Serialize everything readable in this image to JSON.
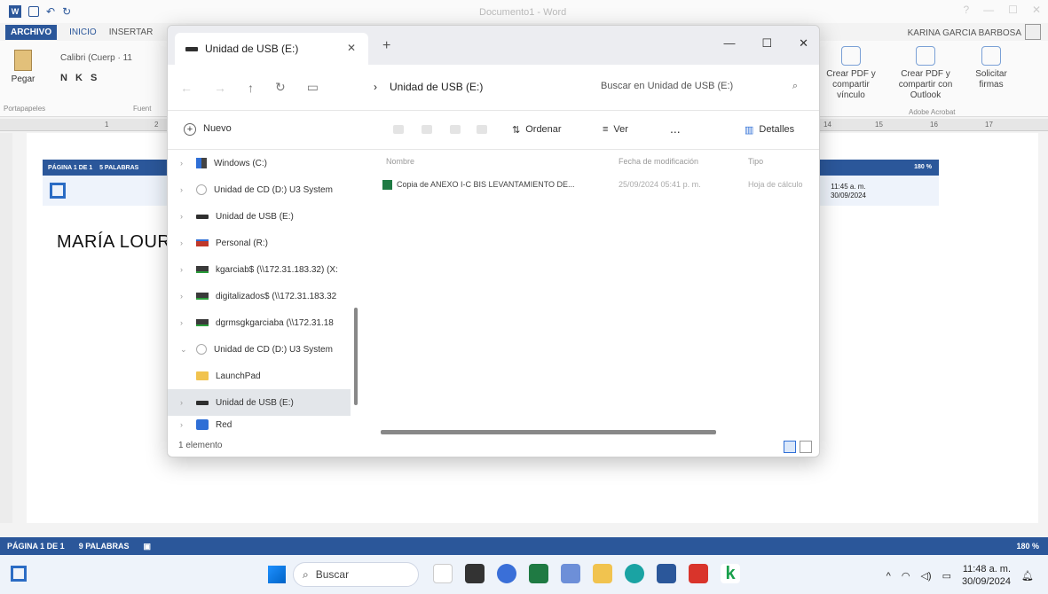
{
  "word": {
    "doc_title": "Documento1 - Word",
    "tabs": {
      "archivo": "ARCHIVO",
      "inicio": "INICIO",
      "insertar": "INSERTAR"
    },
    "user_name": "KARINA GARCIA BARBOSA",
    "ribbon": {
      "paste_label": "Pegar",
      "font_name": "Calibri (Cuerp",
      "font_size": "11",
      "format_buttons": "N K S",
      "clipboard_group": "Portapapeles",
      "font_group": "Fuent",
      "pdf_share_label": "Crear PDF y compartir vínculo",
      "pdf_outlook_label": "Crear PDF y compartir con Outlook",
      "request_signatures_label": "Solicitar firmas",
      "acrobat_group": "Adobe Acrobat"
    },
    "ruler_numbers": [
      "1",
      "2",
      "14",
      "15",
      "16",
      "17"
    ],
    "inner_status": {
      "page": "PÁGINA 1 DE 1",
      "words": "5 PALABRAS",
      "zoom": "180 %",
      "time": "11:45 a. m.",
      "date": "30/09/2024"
    },
    "doc_text": "MARÍA LOURD",
    "status": {
      "page": "PÁGINA 1 DE 1",
      "words": "9 PALABRAS",
      "zoom": "180 %"
    }
  },
  "explorer": {
    "tab_title": "Unidad de USB (E:)",
    "address_path": "Unidad de USB (E:)",
    "search_placeholder": "Buscar en Unidad de USB (E:)",
    "commands": {
      "new": "Nuevo",
      "sort": "Ordenar",
      "view": "Ver",
      "more": "...",
      "details": "Detalles"
    },
    "nav_items": [
      {
        "label": "Windows (C:)",
        "icon": "windows-drive-icon",
        "expanded": false
      },
      {
        "label": "Unidad de CD (D:) U3 System",
        "icon": "cd-drive-icon",
        "expanded": false
      },
      {
        "label": "Unidad de USB (E:)",
        "icon": "usb-drive-icon",
        "expanded": false
      },
      {
        "label": "Personal (R:)",
        "icon": "network-drive-icon",
        "expanded": false
      },
      {
        "label": "kgarciab$ (\\\\172.31.183.32) (X:",
        "icon": "network-drive-icon",
        "expanded": false
      },
      {
        "label": "digitalizados$ (\\\\172.31.183.32",
        "icon": "network-drive-icon",
        "expanded": false
      },
      {
        "label": "dgrmsgkgarciaba (\\\\172.31.18",
        "icon": "network-drive-icon",
        "expanded": false
      },
      {
        "label": "Unidad de CD (D:) U3 System",
        "icon": "cd-drive-icon",
        "expanded": true
      },
      {
        "label": "LaunchPad",
        "icon": "folder-icon",
        "expanded": false
      },
      {
        "label": "Unidad de USB (E:)",
        "icon": "usb-drive-icon",
        "expanded": false,
        "selected": true
      },
      {
        "label": "Red",
        "icon": "network-icon",
        "expanded": false
      }
    ],
    "columns": {
      "name": "Nombre",
      "modified": "Fecha de modificación",
      "type": "Tipo"
    },
    "files": [
      {
        "name": "Copia de ANEXO I-C BIS LEVANTAMIENTO DE...",
        "modified": "25/09/2024 05:41 p. m.",
        "type": "Hoja de cálculo"
      }
    ],
    "status_text": "1 elemento"
  },
  "taskbar": {
    "search_label": "Buscar",
    "time": "11:48 a. m.",
    "date": "30/09/2024"
  },
  "colors": {
    "word_blue": "#2b579a",
    "excel_green": "#1f7a43"
  }
}
